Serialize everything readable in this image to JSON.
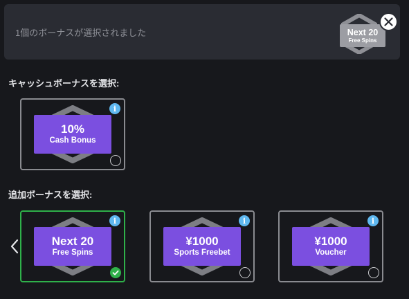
{
  "summary": {
    "text": "1個のボーナスが選択されました",
    "badge_main": "Next 20",
    "badge_sub": "Free Spins"
  },
  "cash_section": {
    "title": "キャッシュボーナスを選択:",
    "cards": [
      {
        "main": "10%",
        "sub": "Cash Bonus",
        "selected": false
      }
    ]
  },
  "additional_section": {
    "title": "追加ボーナスを選択:",
    "cards": [
      {
        "main": "Next 20",
        "sub": "Free Spins",
        "selected": true
      },
      {
        "main": "¥1000",
        "sub": "Sports Freebet",
        "selected": false
      },
      {
        "main": "¥1000",
        "sub": "Voucher",
        "selected": false
      }
    ]
  },
  "icons": {
    "info": "info-icon",
    "close": "close-icon",
    "prev": "chevron-left-icon",
    "check": "check-icon"
  },
  "colors": {
    "accent_purple": "#7b4fe0",
    "selected_green": "#2fb14a",
    "info_blue": "#5fb8f0"
  }
}
